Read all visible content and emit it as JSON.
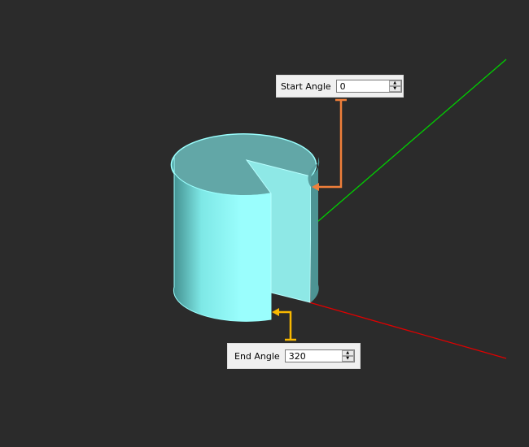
{
  "start_angle": {
    "label": "Start Angle",
    "value": "0"
  },
  "end_angle": {
    "label": "End Angle",
    "value": "320"
  },
  "colors": {
    "start_marker": "#f07f3a",
    "end_marker": "#f8b800",
    "x_axis": "#e00000",
    "y_axis": "#00d000",
    "cylinder": "#8ff7f5"
  },
  "icons": {
    "spin_up": "▲",
    "spin_down": "▼"
  }
}
